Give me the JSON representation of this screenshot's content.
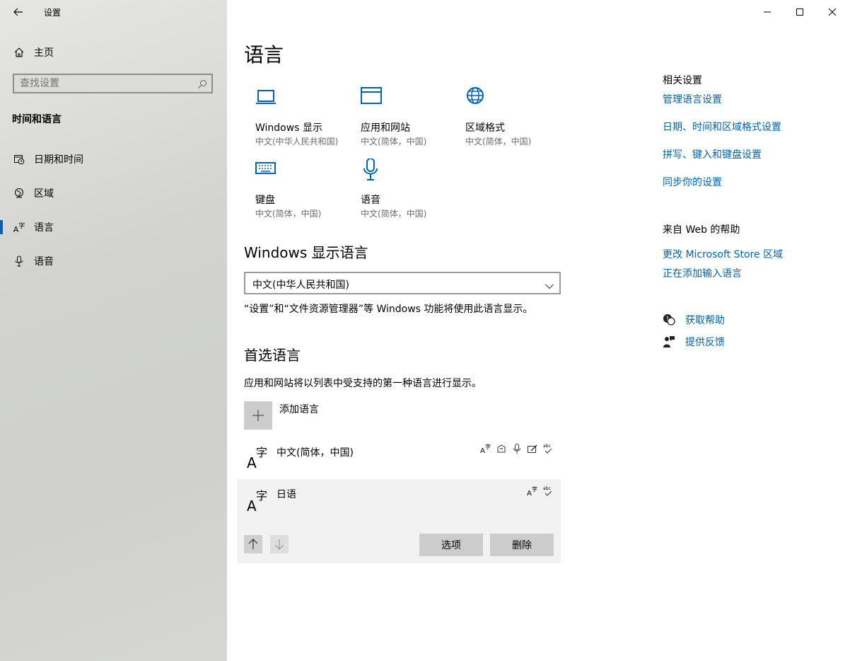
{
  "window": {
    "title": "设置",
    "controls": [
      "minimize-icon",
      "maximize-icon",
      "close-icon"
    ]
  },
  "sidebar": {
    "home_label": "主页",
    "search_placeholder": "查找设置",
    "section_title": "时间和语言",
    "items": [
      {
        "label": "日期和时间",
        "icon": "clock-calendar-icon"
      },
      {
        "label": "区域",
        "icon": "globe-icon"
      },
      {
        "label": "语言",
        "icon": "language-icon",
        "selected": true
      },
      {
        "label": "语音",
        "icon": "microphone-icon"
      }
    ]
  },
  "main": {
    "title": "语言",
    "tiles": [
      {
        "title": "Windows 显示",
        "subtitle": "中文(中华人民共和国)",
        "icon": "laptop-icon"
      },
      {
        "title": "应用和网站",
        "subtitle": "中文(简体，中国)",
        "icon": "window-icon"
      },
      {
        "title": "区域格式",
        "subtitle": "中文(简体，中国)",
        "icon": "globe-icon"
      },
      {
        "title": "键盘",
        "subtitle": "中文(简体，中国)",
        "icon": "keyboard-icon"
      },
      {
        "title": "语音",
        "subtitle": "中文(简体，中国)",
        "icon": "microphone-icon"
      }
    ],
    "display_language": {
      "heading": "Windows 显示语言",
      "selected": "中文(中华人民共和国)",
      "note": "“设置”和“文件资源管理器”等 Windows 功能将使用此语言显示。"
    },
    "preferred": {
      "heading": "首选语言",
      "note": "应用和网站将以列表中受支持的第一种语言进行显示。",
      "add_label": "添加语言",
      "languages": [
        {
          "name": "中文(简体，中国)",
          "features": [
            "display-language-icon",
            "text-to-speech-icon",
            "speech-recognition-icon",
            "handwriting-icon",
            "spellcheck-icon"
          ]
        },
        {
          "name": "日语",
          "features": [
            "display-language-icon",
            "spellcheck-icon"
          ],
          "selected": true
        }
      ],
      "options_label": "选项",
      "remove_label": "删除"
    }
  },
  "related": {
    "heading": "相关设置",
    "links": [
      "管理语言设置",
      "日期、时间和区域格式设置",
      "拼写、键入和键盘设置",
      "同步你的设置"
    ],
    "web_help_heading": "来自 Web 的帮助",
    "web_links": [
      "更改 Microsoft Store 区域",
      "正在添加输入语言"
    ],
    "get_help": "获取帮助",
    "feedback": "提供反馈"
  },
  "colors": {
    "accent": "#0063b1",
    "sidebar": "#d2d3cf"
  }
}
